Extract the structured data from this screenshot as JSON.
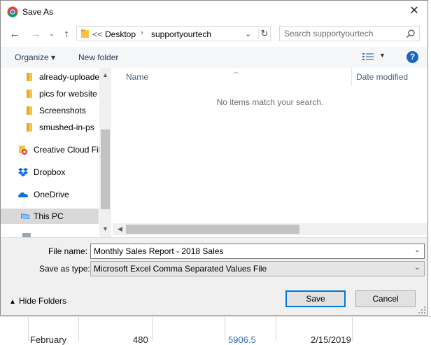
{
  "window": {
    "title": "Save As",
    "close_label": "✕"
  },
  "navigation": {
    "back_label": "←",
    "forward_label": "→",
    "up_label": "↑",
    "address": {
      "prefix": "<<",
      "crumbs": [
        "Desktop",
        "supportyourtech"
      ]
    },
    "search_placeholder": "Search supportyourtech"
  },
  "toolbar": {
    "organize_label": "Organize ▾",
    "new_folder_label": "New folder",
    "help_label": "?"
  },
  "nav_pane": {
    "items": [
      {
        "label": "already-uploade",
        "icon": "folder-icon"
      },
      {
        "label": "pics for website",
        "icon": "folder-icon"
      },
      {
        "label": "Screenshots",
        "icon": "folder-icon"
      },
      {
        "label": "smushed-in-ps",
        "icon": "folder-icon"
      },
      {
        "label": "Creative Cloud Fil",
        "icon": "creative-cloud-icon"
      },
      {
        "label": "Dropbox",
        "icon": "dropbox-icon"
      },
      {
        "label": "OneDrive",
        "icon": "onedrive-icon"
      },
      {
        "label": "This PC",
        "icon": "this-pc-icon",
        "selected": true
      }
    ]
  },
  "file_list": {
    "columns": [
      "Name",
      "Date modified"
    ],
    "empty_message": "No items match your search."
  },
  "form": {
    "file_name_label": "File name:",
    "file_name_value": "Monthly Sales Report - 2018 Sales",
    "save_type_label": "Save as type:",
    "save_type_value": "Microsoft Excel Comma Separated Values File"
  },
  "footer": {
    "hide_folders_label": "Hide Folders",
    "save_label": "Save",
    "cancel_label": "Cancel"
  },
  "background_sheet": {
    "cells": [
      "February",
      "480",
      "5906.5",
      "2/15/2019"
    ]
  },
  "colors": {
    "accent": "#0078d7",
    "help": "#1a64c8",
    "link_text": "#1e395b",
    "folder": "#f6c342"
  }
}
